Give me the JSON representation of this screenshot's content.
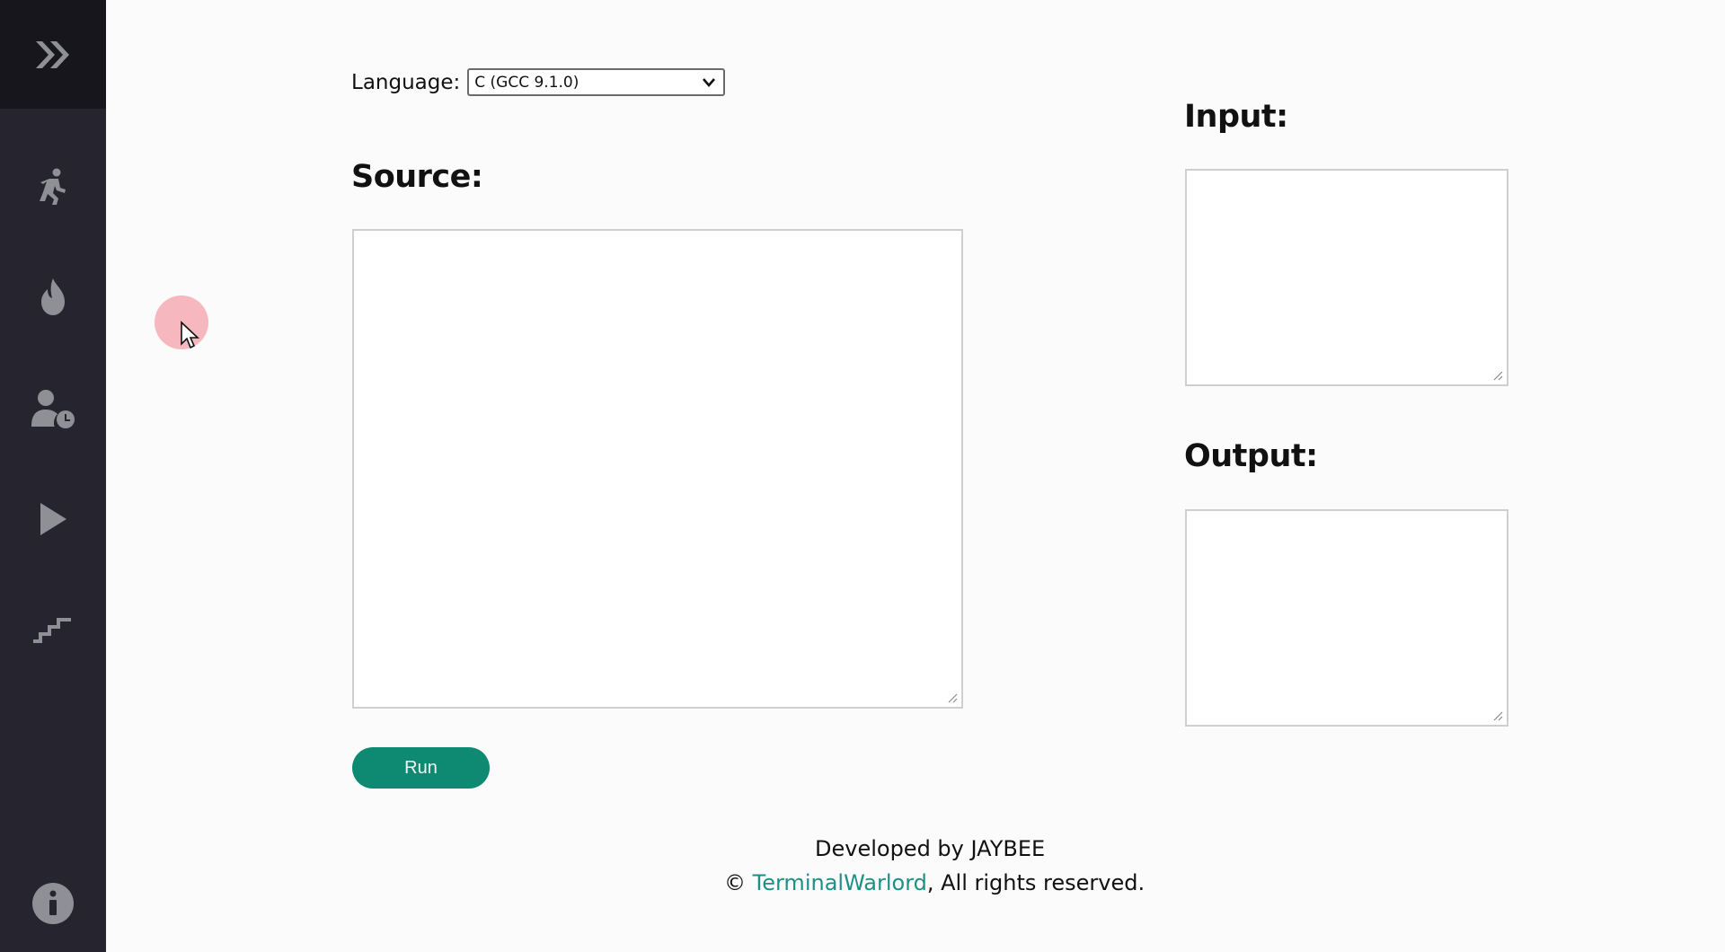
{
  "sidebar": {
    "items": [
      {
        "name": "expand-icon"
      },
      {
        "name": "running-person-icon"
      },
      {
        "name": "flame-icon"
      },
      {
        "name": "user-clock-icon"
      },
      {
        "name": "play-icon"
      },
      {
        "name": "stairs-icon"
      },
      {
        "name": "info-icon"
      }
    ]
  },
  "language": {
    "label": "Language:",
    "selected": "C (GCC 9.1.0)"
  },
  "source": {
    "heading": "Source:",
    "value": ""
  },
  "input": {
    "heading": "Input:",
    "value": ""
  },
  "output": {
    "heading": "Output:",
    "value": ""
  },
  "run": {
    "label": "Run"
  },
  "footer": {
    "developed_by": "Developed by JAYBEE",
    "copyright_symbol": "©",
    "link_text": "TerminalWarlord",
    "rights": ", All rights reserved."
  },
  "colors": {
    "sidebar_bg": "#26242f",
    "sidebar_top_bg": "#17161c",
    "run_button": "#0f8a72",
    "link": "#1e8f86"
  }
}
